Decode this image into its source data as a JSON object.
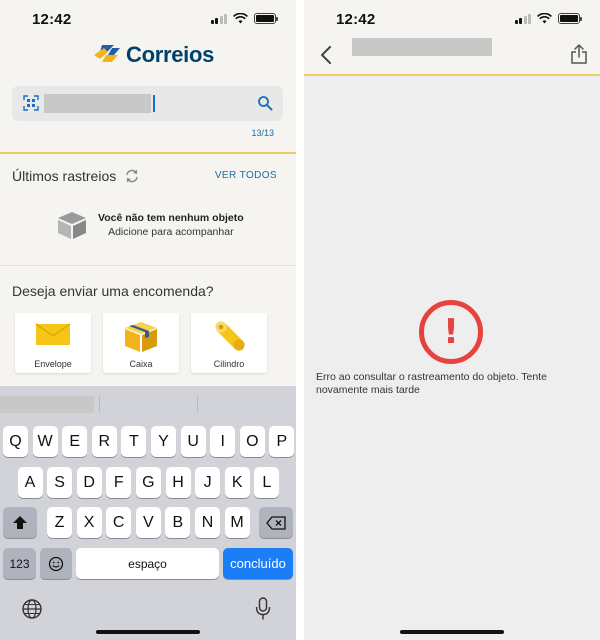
{
  "status_bar": {
    "time": "12:42"
  },
  "left": {
    "logo_text": "Correios",
    "search": {
      "counter": "13/13"
    },
    "recent": {
      "title": "Últimos rastreios",
      "see_all": "VER TODOS",
      "empty_title": "Você não tem nenhum objeto",
      "empty_subtitle": "Adicione para acompanhar"
    },
    "send": {
      "title": "Deseja enviar uma encomenda?",
      "options": [
        {
          "label": "Envelope",
          "icon": "envelope-icon"
        },
        {
          "label": "Caixa",
          "icon": "box-icon"
        },
        {
          "label": "Cilindro",
          "icon": "cylinder-icon"
        }
      ]
    },
    "keyboard": {
      "row1": [
        "Q",
        "W",
        "E",
        "R",
        "T",
        "Y",
        "U",
        "I",
        "O",
        "P"
      ],
      "row2": [
        "A",
        "S",
        "D",
        "F",
        "G",
        "H",
        "J",
        "K",
        "L"
      ],
      "row3": [
        "Z",
        "X",
        "C",
        "V",
        "B",
        "N",
        "M"
      ],
      "numbers_key": "123",
      "space_key": "espaço",
      "done_key": "concluído"
    }
  },
  "right": {
    "error_message": "Erro ao consultar o rastreamento do objeto. Tente novamente mais tarde"
  },
  "colors": {
    "accent_yellow": "#e8d060",
    "link_blue": "#1a6fa0",
    "error_red": "#e5443e",
    "brand_blue": "#00416b"
  }
}
